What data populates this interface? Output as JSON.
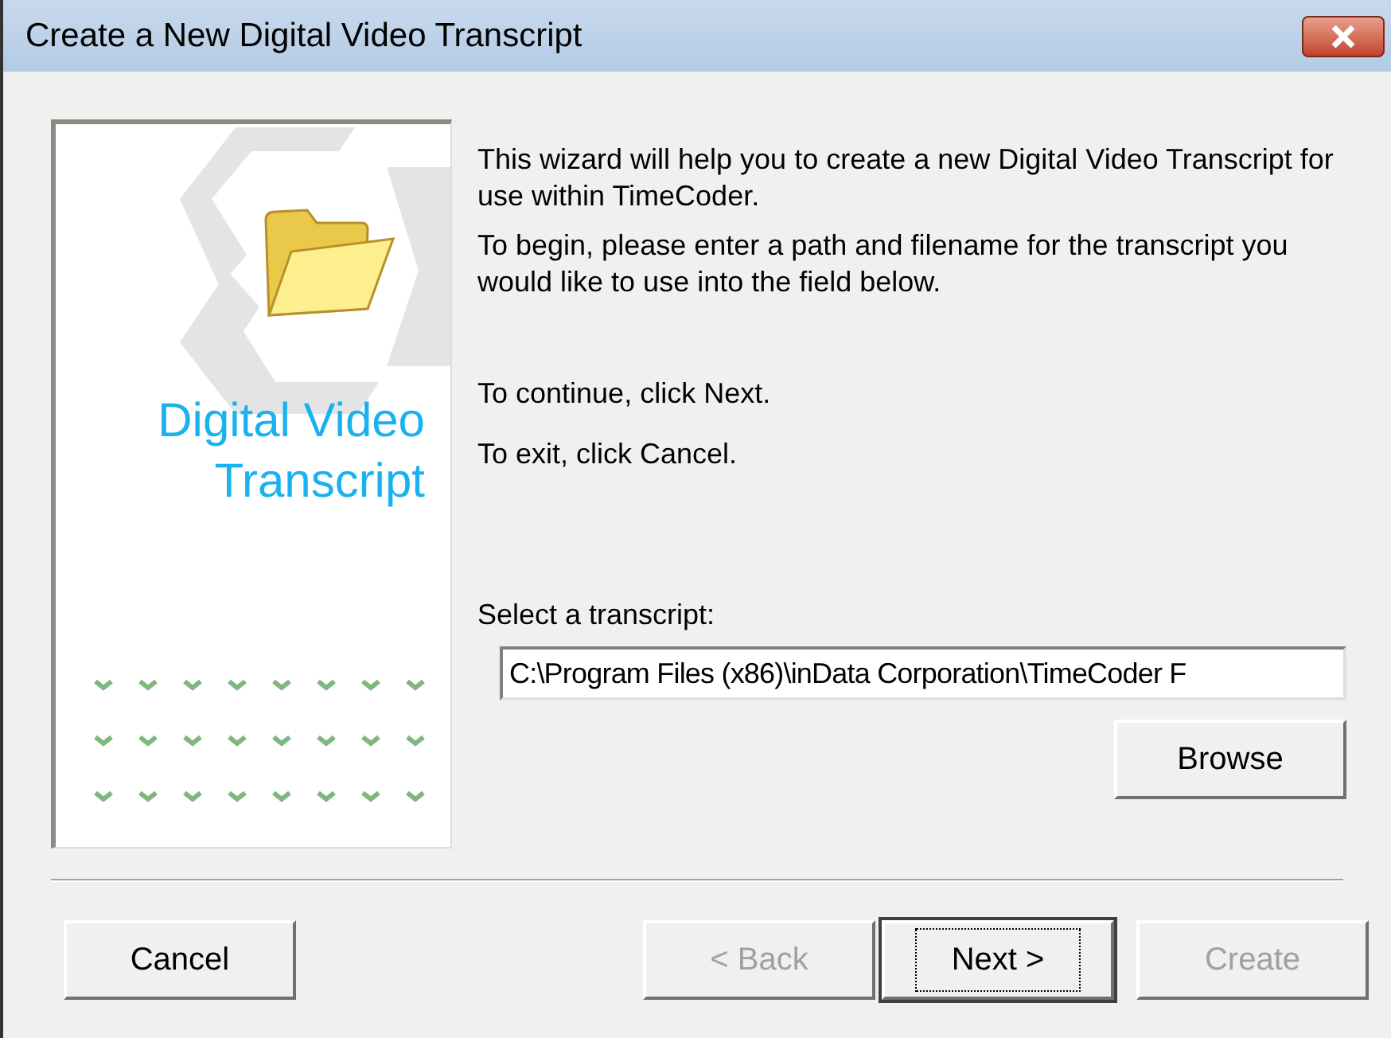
{
  "window": {
    "title": "Create a New Digital Video Transcript"
  },
  "side_panel": {
    "heading_lines": [
      "Digital Video",
      "Transcript"
    ]
  },
  "paragraphs": [
    "This wizard will help you to create a new Digital Video Transcript for use within TimeCoder.",
    "To begin, please enter a path and filename for the transcript you would like to use into the field below.",
    "To continue, click Next.",
    "To exit, click Cancel."
  ],
  "transcript_field": {
    "label": "Select a transcript:",
    "value": "C:\\Program Files (x86)\\inData Corporation\\TimeCoder F"
  },
  "browse_button": {
    "label": "Browse",
    "disabled": false
  },
  "buttons": [
    {
      "label": "Cancel",
      "disabled": false,
      "focused": false
    },
    {
      "label": "< Back",
      "disabled": true,
      "focused": false
    },
    {
      "label": "Next >",
      "disabled": false,
      "focused": true
    },
    {
      "label": "Create",
      "disabled": true,
      "focused": false
    }
  ]
}
